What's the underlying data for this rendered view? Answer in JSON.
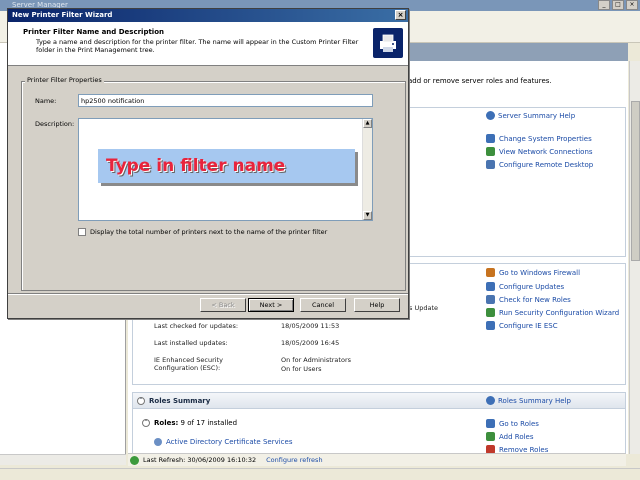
{
  "server_manager": {
    "title": "Server Manager",
    "intro": "add or remove server roles and features.",
    "server_summary_help": "Server Summary Help",
    "computer_links": [
      {
        "label": "Change System Properties",
        "color": "#3d6fb6"
      },
      {
        "label": "View Network Connections",
        "color": "#3d8f3d"
      },
      {
        "label": "Configure Remote Desktop",
        "color": "#4a74b0"
      }
    ],
    "security_links": [
      {
        "label": "Go to Windows Firewall",
        "color": "#c7731f"
      },
      {
        "label": "Configure Updates",
        "color": "#3d6fb6"
      },
      {
        "label": "Check for New Roles",
        "color": "#4a74b0"
      },
      {
        "label": "Run Security Configuration Wizard",
        "color": "#3d8f3d"
      },
      {
        "label": "Configure IE ESC",
        "color": "#3d6fb6"
      }
    ],
    "updates_fragment": "s Update",
    "last_checked_label": "Last checked for updates:",
    "last_checked_value": "18/05/2009 11:53",
    "last_installed_label": "Last installed updates:",
    "last_installed_value": "18/05/2009 16:45",
    "ie_esc_label": "IE Enhanced Security Configuration (ESC):",
    "ie_esc_value_1": "On for Administrators",
    "ie_esc_value_2": "On for Users",
    "roles_summary_title": "Roles Summary",
    "roles_summary_help": "Roles Summary Help",
    "roles_label": "Roles:",
    "roles_count": "9 of 17 installed",
    "role_item": "Active Directory Certificate Services",
    "roles_links": [
      {
        "label": "Go to Roles",
        "color": "#3d6fb6"
      },
      {
        "label": "Add Roles",
        "color": "#3d8f3d"
      },
      {
        "label": "Remove Roles",
        "color": "#c0392b"
      }
    ],
    "last_refresh": "Last Refresh: 30/06/2009 16:10:32",
    "configure_refresh": "Configure refresh"
  },
  "wizard": {
    "title": "New Printer Filter Wizard",
    "header_title": "Printer Filter Name and Description",
    "header_desc": "Type a name and description for the printer filter. The name will appear in the Custom Printer Filter folder in the Print Management tree.",
    "group_label": "Printer Filter Properties",
    "name_label": "Name:",
    "name_value": "hp2500 notification",
    "description_label": "Description:",
    "checkbox_label": "Display the total number of printers next to the name of the printer filter",
    "buttons": {
      "back": "< Back",
      "next": "Next >",
      "cancel": "Cancel",
      "help": "Help"
    }
  },
  "callout": {
    "text": "Type in filter name"
  }
}
